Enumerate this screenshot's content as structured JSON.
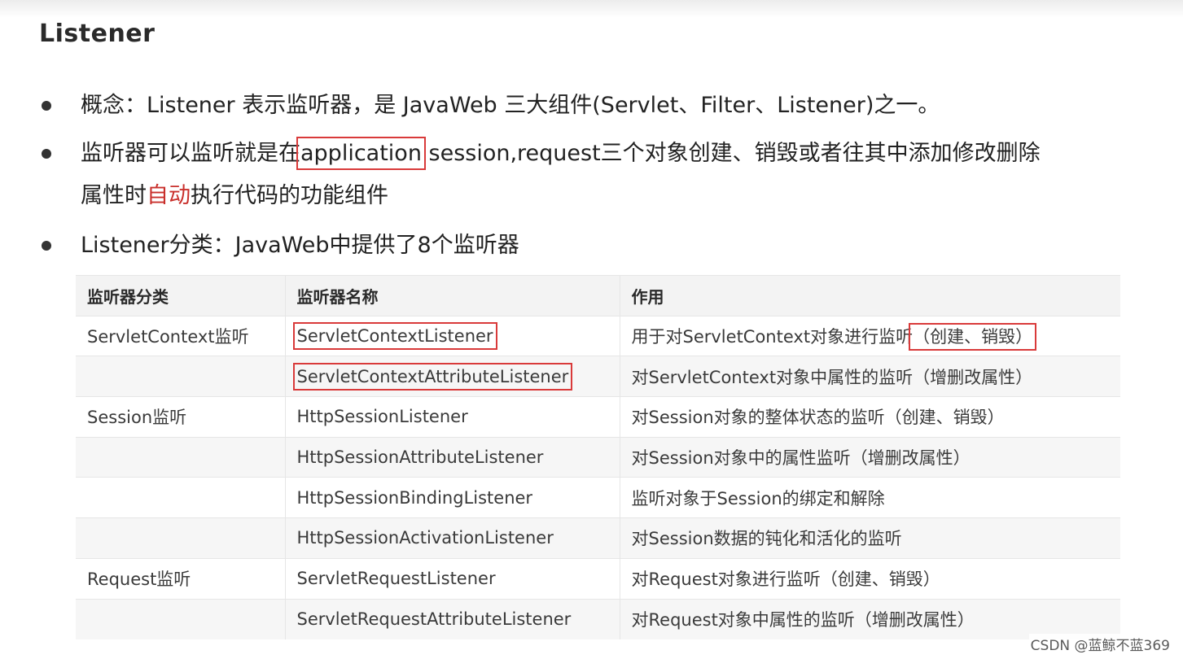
{
  "title": "Listener",
  "bullets": {
    "b1": "概念：Listener 表示监听器，是 JavaWeb 三大组件(Servlet、Filter、Listener)之一。",
    "b2_pre": "监听器可以监听就是在",
    "b2_boxed": "application",
    "b2_post": " session,request三个对象创建、销毁或者往其中添加修改删除",
    "b2_line2_pre": "属性时",
    "b2_line2_accent": "自动",
    "b2_line2_post": "执行代码的功能组件",
    "b3": "Listener分类：JavaWeb中提供了8个监听器"
  },
  "table": {
    "headers": [
      "监听器分类",
      "监听器名称",
      "作用"
    ],
    "rows": [
      {
        "category": "ServletContext监听",
        "name": "ServletContextListener",
        "purpose_main": "用于对ServletContext对象进行监听",
        "purpose_boxed": "（创建、销毁）"
      },
      {
        "category": "",
        "name": "ServletContextAttributeListener",
        "purpose_main": "对ServletContext对象中属性的监听（增删改属性）",
        "purpose_boxed": ""
      },
      {
        "category": "Session监听",
        "name": "HttpSessionListener",
        "purpose_main": "对Session对象的整体状态的监听（创建、销毁）",
        "purpose_boxed": ""
      },
      {
        "category": "",
        "name": "HttpSessionAttributeListener",
        "purpose_main": "对Session对象中的属性监听（增删改属性）",
        "purpose_boxed": ""
      },
      {
        "category": "",
        "name": "HttpSessionBindingListener",
        "purpose_main": "监听对象于Session的绑定和解除",
        "purpose_boxed": ""
      },
      {
        "category": "",
        "name": "HttpSessionActivationListener",
        "purpose_main": "对Session数据的钝化和活化的监听",
        "purpose_boxed": ""
      },
      {
        "category": "Request监听",
        "name": "ServletRequestListener",
        "purpose_main": "对Request对象进行监听（创建、销毁）",
        "purpose_boxed": ""
      },
      {
        "category": "",
        "name": "ServletRequestAttributeListener",
        "purpose_main": "对Request对象中属性的监听（增删改属性）",
        "purpose_boxed": ""
      }
    ]
  },
  "watermark": "CSDN @蓝鲸不蓝369",
  "colors": {
    "highlight_box": "#d93a3a",
    "accent_text": "#c9302c"
  }
}
